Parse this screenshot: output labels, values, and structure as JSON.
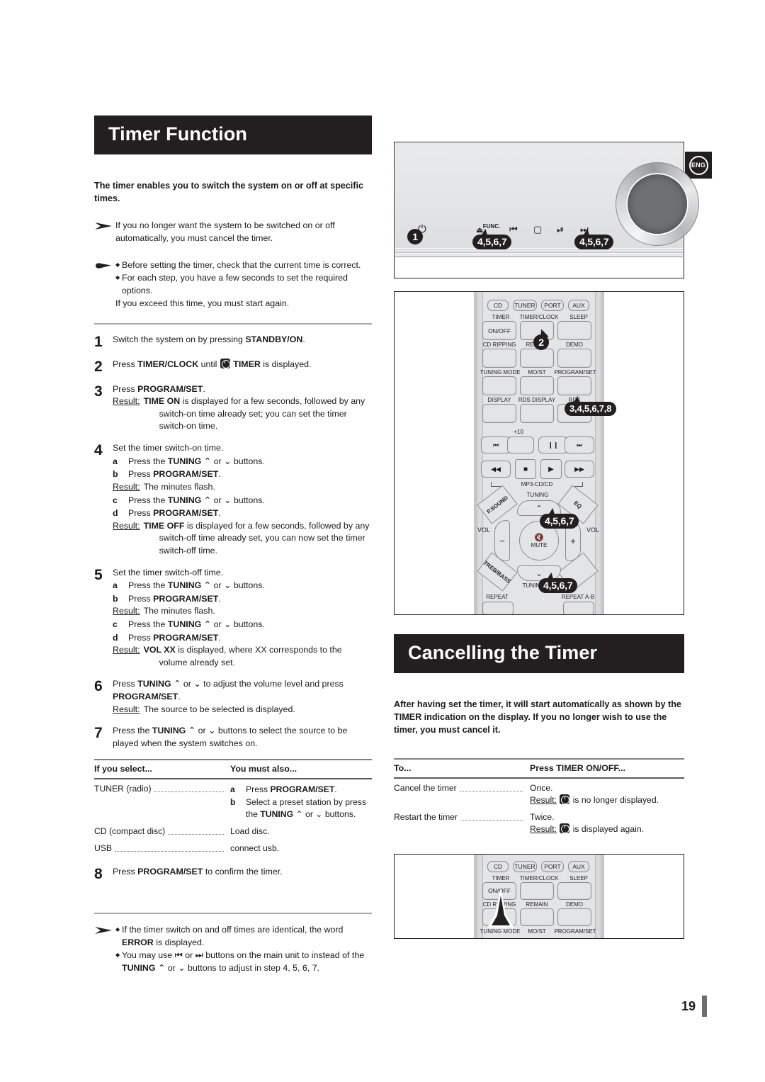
{
  "lang_badge": "ENG",
  "page_number": "19",
  "left": {
    "title": "Timer Function",
    "intro": "The timer enables you to switch the system on or off at specific times.",
    "note1": "If you no longer want the system to be switched on or off automatically, you must cancel the timer.",
    "note2_a": "Before setting the timer, check that the current time is correct.",
    "note2_b": "For each step, you have a few seconds to set the required options.",
    "note2_c": "If you exceed this time, you must start again.",
    "steps": [
      {
        "num": "1",
        "text_pre": "Switch the system on by pressing ",
        "bold": "STANDBY/ON",
        "text_post": "."
      },
      {
        "num": "2",
        "text_pre": "Press ",
        "bold": "TIMER/CLOCK",
        "text_mid": " until ",
        "icon": "clock-icon",
        "bold2": "TIMER",
        "text_post": " is displayed."
      },
      {
        "num": "3",
        "text_pre": "Press ",
        "bold": "PROGRAM/SET",
        "text_post": ".",
        "result_label": "Result:",
        "result_bold": "TIME ON",
        "result_text": " is displayed for a few seconds, followed by any",
        "result_cont": "switch-on time already set; you can set the timer switch-on time."
      },
      {
        "num": "4",
        "text_pre": "Set the timer switch-on time.",
        "sub": [
          {
            "ltr": "a",
            "pre": "Press the ",
            "b": "TUNING",
            "mid": " ⌃ or ⌄ ",
            "post": "buttons."
          },
          {
            "ltr": "b",
            "pre": "Press ",
            "b": "PROGRAM/SET",
            "post": "."
          }
        ],
        "result1_label": "Result:",
        "result1_text": " The minutes flash.",
        "sub2": [
          {
            "ltr": "c",
            "pre": "Press the ",
            "b": "TUNING",
            "mid": " ⌃ or ⌄ ",
            "post": "buttons."
          },
          {
            "ltr": "d",
            "pre": "Press ",
            "b": "PROGRAM/SET",
            "post": "."
          }
        ],
        "result2_label": "Result:",
        "result2_bold": "TIME OFF",
        "result2_text": " is displayed for a few seconds, followed by any",
        "result2_cont": "switch-off time already set, you can now set the timer switch-off time."
      },
      {
        "num": "5",
        "text_pre": "Set the timer switch-off time.",
        "sub": [
          {
            "ltr": "a",
            "pre": "Press the ",
            "b": "TUNING",
            "mid": " ⌃ or ⌄ ",
            "post": "buttons."
          },
          {
            "ltr": "b",
            "pre": "Press ",
            "b": "PROGRAM/SET",
            "post": "."
          }
        ],
        "result1_label": "Result:",
        "result1_text": " The minutes flash.",
        "sub2": [
          {
            "ltr": "c",
            "pre": "Press the ",
            "b": "TUNING",
            "mid": " ⌃ or ⌄ ",
            "post": "buttons."
          },
          {
            "ltr": "d",
            "pre": "Press ",
            "b": "PROGRAM/SET",
            "post": "."
          }
        ],
        "result2_label": "Result:",
        "result2_bold": "VOL XX",
        "result2_text": " is displayed, where XX corresponds to the",
        "result2_cont": "volume already set."
      },
      {
        "num": "6",
        "text_pre": "Press ",
        "bold": "TUNING",
        "text_mid": " ⌃ or ⌄ to adjust the volume level and press ",
        "bold2": "PROGRAM/SET",
        "text_post": ".",
        "result_label": "Result:",
        "result_text": " The source to be selected is displayed."
      },
      {
        "num": "7",
        "text_pre": "Press the ",
        "bold": "TUNING",
        "text_mid": " ⌃ or ⌄ buttons to select the source to be played when the system switches on."
      },
      {
        "num": "8",
        "text_pre": "Press ",
        "bold": "PROGRAM/SET",
        "text_post": " to confirm the timer."
      }
    ],
    "table": {
      "headers": [
        "If you select...",
        "You must also..."
      ],
      "rows": [
        {
          "name": "TUNER (radio)",
          "kind": "list",
          "items": [
            {
              "ltr": "a",
              "pre": "Press ",
              "b": "PROGRAM/SET",
              "post": "."
            },
            {
              "ltr": "b",
              "pre": "Select a preset station by press the ",
              "b": "TUNING",
              "post": " ⌃ or ⌄ buttons."
            }
          ]
        },
        {
          "name": "CD (compact disc)",
          "kind": "text",
          "value": "Load disc."
        },
        {
          "name": "USB",
          "kind": "text",
          "value": "connect usb."
        }
      ]
    },
    "footnote_a1": "If the timer switch on and off times are identical, the word ",
    "footnote_a_bold": "ERROR",
    "footnote_a2": " is displayed.",
    "footnote_b1": "You may use ⏮ or ⏭ buttons on the main unit to instead of the ",
    "footnote_b_bold": "TUNING",
    "footnote_b2": " ⌃ or ⌄ buttons to adjust in step 4, 5, 6, 7."
  },
  "right": {
    "title": "Cancelling the Timer",
    "body": "After having set the timer, it will start automatically as shown by the TIMER indication on the display. If you no longer wish to use the timer, you must cancel it.",
    "table": {
      "headers": [
        "To...",
        "Press TIMER ON/OFF..."
      ],
      "rows": [
        {
          "name": "Cancel the timer",
          "value": "Once.",
          "result_label": "Result:",
          "result_text": " is no longer displayed."
        },
        {
          "name": "Restart the timer",
          "value": "Twice.",
          "result_label": "Result:",
          "result_text": " is displayed again."
        }
      ]
    }
  },
  "unit": {
    "callout_power": "1",
    "callout_prev": "4,5,6,7",
    "callout_next": "4,5,6,7",
    "labels": {
      "func": "FUNC.",
      "eject": "△",
      "prev": "⏮",
      "stop": "□",
      "play": "▶❙",
      "next": "⏭",
      "power": "⏻"
    }
  },
  "remote": {
    "source_buttons": [
      "CD",
      "TUNER",
      "PORT",
      "AUX"
    ],
    "row1_labels": [
      "TIMER",
      "TIMER/CLOCK",
      "SLEEP"
    ],
    "row1_first_button": "ON/OFF",
    "row2_labels": [
      "CD RIPPING",
      "REMAIN",
      "DEMO"
    ],
    "row3_labels": [
      "TUNING MODE",
      "MO/ST",
      "PROGRAM/SET"
    ],
    "row4_labels": [
      "DISPLAY",
      "RDS DISPLAY",
      "RDS"
    ],
    "plus10": "+10",
    "transport1": [
      "⏮",
      "",
      "❙❙",
      "⏭"
    ],
    "transport2": [
      "◀◀",
      "■",
      "▶",
      "▶▶"
    ],
    "mp3_label": "MP3-CD/CD",
    "psound": "P.SOUND",
    "eq": "EQ",
    "treb_bass": "TREB/BASS",
    "tuning_label": "TUNING",
    "tuning_label_bottom": "TUNING",
    "vol_left": "VOL",
    "vol_right": "VOL",
    "minus": "−",
    "plus": "+",
    "mute": "MUTE",
    "repeat": "REPEAT",
    "repeat_ab": "REPEAT A-B",
    "callout_2": "2",
    "callout_program": "3,4,5,6,7,8",
    "callout_tuning_up": "4,5,6,7",
    "callout_tuning_dn": "4,5,6,7"
  },
  "remote2": {
    "source_buttons": [
      "CD",
      "TUNER",
      "PORT",
      "AUX"
    ],
    "row1_labels": [
      "TIMER",
      "TIMER/CLOCK",
      "SLEEP"
    ],
    "row1_first_button": "ON/OFF",
    "row2_labels": [
      "CD RIPPING",
      "REMAIN",
      "DEMO"
    ],
    "row3_labels": [
      "TUNING MODE",
      "MO/ST",
      "PROGRAM/SET"
    ]
  }
}
